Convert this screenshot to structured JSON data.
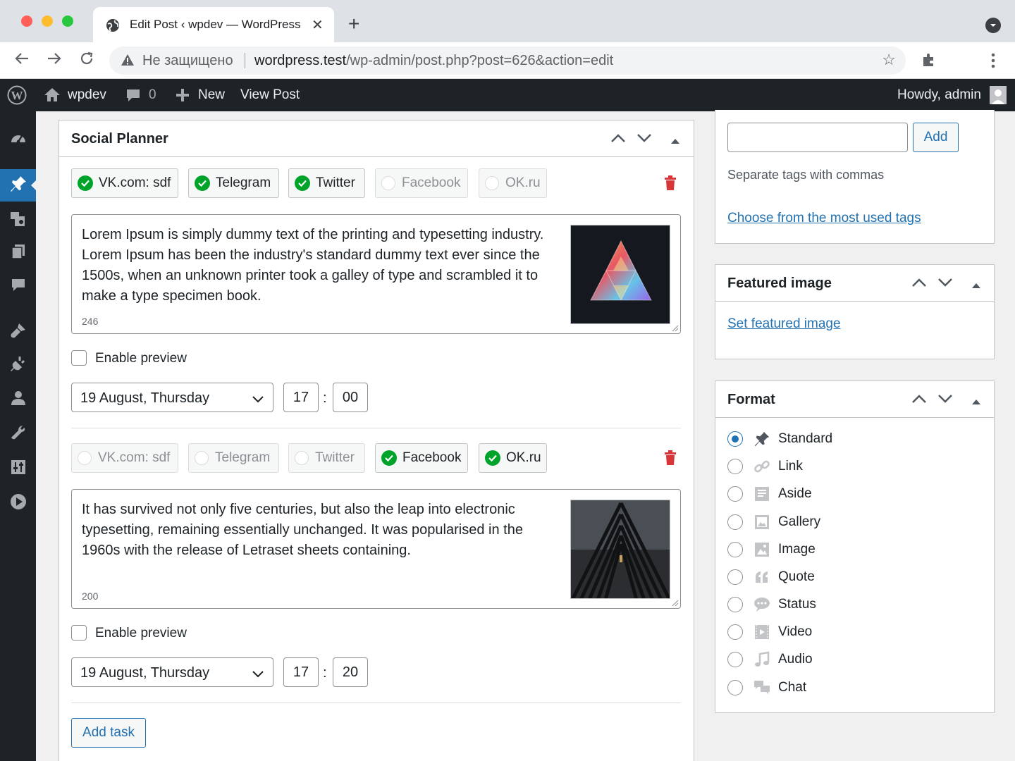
{
  "browser": {
    "tab_title": "Edit Post ‹ wpdev — WordPress",
    "new_tab": "+",
    "insecure_label": "Не защищено",
    "url_host": "wordpress.test",
    "url_path": "/wp-admin/post.php?post=626&action=edit"
  },
  "adminbar": {
    "site_name": "wpdev",
    "comments_count": "0",
    "new_label": "New",
    "view_post": "View Post",
    "howdy": "Howdy, admin"
  },
  "social_planner": {
    "title": "Social Planner",
    "tasks": [
      {
        "channels": [
          {
            "label": "VK.com: sdf",
            "checked": true
          },
          {
            "label": "Telegram",
            "checked": true
          },
          {
            "label": "Twitter",
            "checked": true
          },
          {
            "label": "Facebook",
            "checked": false
          },
          {
            "label": "OK.ru",
            "checked": false
          }
        ],
        "message": "Lorem Ipsum is simply dummy text of the printing and typesetting industry. Lorem Ipsum has been the industry's standard dummy text ever since the 1500s, when an unknown printer took a galley of type and scrambled it to make a type specimen book.",
        "count": "246",
        "preview_label": "Enable preview",
        "date": "19 August, Thursday",
        "hour": "17",
        "minute": "00"
      },
      {
        "channels": [
          {
            "label": "VK.com: sdf",
            "checked": false
          },
          {
            "label": "Telegram",
            "checked": false
          },
          {
            "label": "Twitter",
            "checked": false
          },
          {
            "label": "Facebook",
            "checked": true
          },
          {
            "label": "OK.ru",
            "checked": true
          }
        ],
        "message": "It has survived not only five centuries, but also the leap into electronic typesetting, remaining essentially unchanged. It was popularised in the 1960s with the release of Letraset sheets containing.",
        "count": "200",
        "preview_label": "Enable preview",
        "date": "19 August, Thursday",
        "hour": "17",
        "minute": "20"
      }
    ],
    "add_task": "Add task",
    "colon": ":"
  },
  "tags": {
    "add_button": "Add",
    "hint": "Separate tags with commas",
    "most_used_link": "Choose from the most used tags"
  },
  "featured_image": {
    "title": "Featured image",
    "link": "Set featured image"
  },
  "format": {
    "title": "Format",
    "options": [
      "Standard",
      "Link",
      "Aside",
      "Gallery",
      "Image",
      "Quote",
      "Status",
      "Video",
      "Audio",
      "Chat"
    ],
    "selected": "Standard"
  },
  "colors": {
    "accent": "#2271b1",
    "admin_bar": "#1d2327",
    "success": "#00a32a",
    "danger": "#d63638"
  }
}
